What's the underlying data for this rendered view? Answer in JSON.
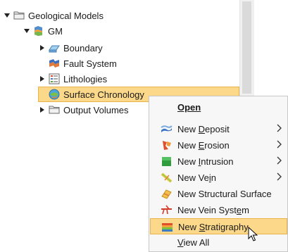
{
  "tree": {
    "root": {
      "label": "Geological Models"
    },
    "model": {
      "label": "GM"
    },
    "items": [
      {
        "label": "Boundary"
      },
      {
        "label": "Fault System"
      },
      {
        "label": "Lithologies"
      },
      {
        "label": "Surface Chronology"
      },
      {
        "label": "Output Volumes"
      }
    ]
  },
  "menu": {
    "open": {
      "label": "Open"
    },
    "new_deposit": {
      "pre": "New ",
      "u": "D",
      "post": "eposit"
    },
    "new_erosion": {
      "pre": "New ",
      "u": "E",
      "post": "rosion"
    },
    "new_intrusion": {
      "pre": "New ",
      "u": "I",
      "post": "ntrusion"
    },
    "new_vein": {
      "pre": "New Ve",
      "u": "i",
      "post": "n"
    },
    "new_structural_surface": {
      "label": "New Structural Surface"
    },
    "new_vein_system": {
      "pre": "New Vein Syst",
      "u": "e",
      "post": "m"
    },
    "new_stratigraphy": {
      "pre": "New ",
      "u": "S",
      "post": "tratigraphy"
    },
    "view_all": {
      "u": "V",
      "post": "iew All"
    }
  },
  "colors": {
    "selection": "#fcd98a",
    "selection_border": "#e9b24b"
  }
}
